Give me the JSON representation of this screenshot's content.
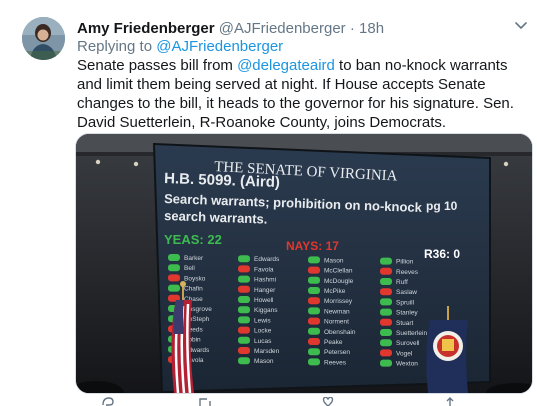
{
  "tweet": {
    "author_name": "Amy Friedenberger",
    "author_handle": "@AJFriedenberger",
    "separator": "·",
    "timestamp": "18h",
    "replying_prefix": "Replying to ",
    "replying_to": "@AJFriedenberger",
    "text_before_link": "Senate passes bill from ",
    "mention": "@delegateaird",
    "text_after_link": " to ban no-knock warrants and limit them being served at night. If House accepts Senate changes to the bill, it heads to the governor for his signature. Sen. David Suetterlein, R-Roanoke County, joins Democrats."
  },
  "board": {
    "title": "THE SENATE OF VIRGINIA",
    "bill": "H.B. 5099. (Aird)",
    "description_line1": "Search warrants; prohibition on no-knock",
    "description_line2": "search warrants.",
    "page": "pg 10",
    "yeas": "YEAS: 22",
    "nays": "NAYS: 17",
    "r36": "R36: 0",
    "names_col1": [
      "Barker",
      "Bell",
      "Boysko",
      "Chafin",
      "Chase",
      "Cosgrove",
      "DeSteph",
      "Deeds",
      "Ebbin",
      "Edwards",
      "Favola"
    ],
    "names_col2": [
      "Edwards",
      "Favola",
      "Hashmi",
      "Hanger",
      "Howell",
      "Kiggans",
      "Lewis",
      "Locke",
      "Lucas",
      "Marsden",
      "Mason"
    ],
    "names_col3": [
      "Mason",
      "McClellan",
      "McDougle",
      "McPike",
      "Morrissey",
      "Newman",
      "Norment",
      "Obenshain",
      "Peake",
      "Petersen",
      "Reeves"
    ],
    "names_col4": [
      "Pillion",
      "Reeves",
      "Ruff",
      "Saslaw",
      "Spruill",
      "Stanley",
      "Stuart",
      "Suetterlein",
      "Surovell",
      "Vogel",
      "Wexton"
    ]
  },
  "icons": {
    "chevron": "chevron-down-icon",
    "reply": "reply-icon",
    "retweet": "retweet-icon",
    "like": "like-icon",
    "share": "share-icon"
  },
  "colors": {
    "link": "#1b95e0",
    "secondary_text": "#657786",
    "board_text": "#e9ecef",
    "yeas": "#3dbb4f",
    "nays": "#e0382f",
    "r36": "#ffffff"
  }
}
